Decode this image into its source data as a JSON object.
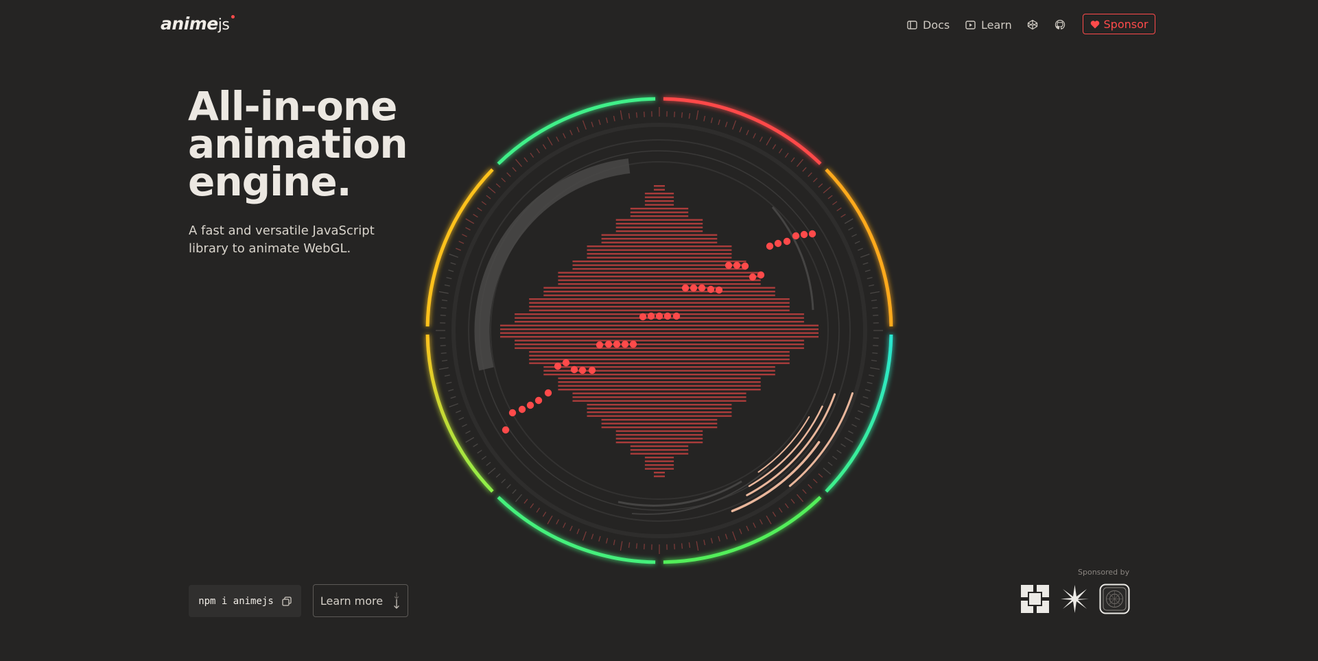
{
  "brand": {
    "name": "anime",
    "suffix": "js",
    "accent": "#ff4b4b"
  },
  "nav": {
    "docs": "Docs",
    "learn": "Learn",
    "codepen_icon": "codepen-icon",
    "github_icon": "github-icon",
    "sponsor": "Sponsor"
  },
  "hero": {
    "title_line1": "All-in-one",
    "title_line2": "animation",
    "title_line3": "engine.",
    "subtitle": "A fast and versatile JavaScript library to animate WebGL."
  },
  "actions": {
    "npm_command": "npm i animejs",
    "learn_more": "Learn more"
  },
  "sponsors": {
    "label": "Sponsored by",
    "logos": [
      "sponsor-logo-blocks",
      "sponsor-logo-star",
      "sponsor-logo-badge"
    ]
  },
  "colors": {
    "background": "#252423",
    "accent_red": "#ff4b4b",
    "ring_green": "#4ff07a",
    "ring_yellow": "#ffb21e",
    "ring_cyan": "#2ee8c8"
  }
}
